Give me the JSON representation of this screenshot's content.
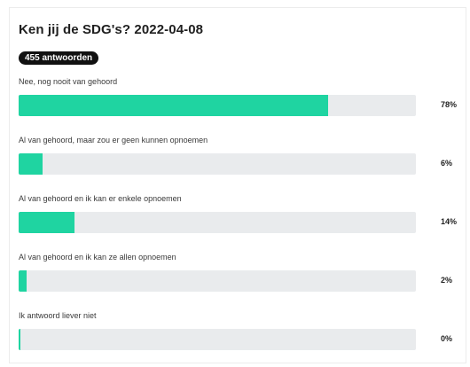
{
  "poll": {
    "title": "Ken jij de SDG's? 2022-04-08",
    "responses_label": "455 antwoorden",
    "colors": {
      "fill": "#1fd4a1",
      "track": "#e9ebed",
      "badge": "#111111"
    },
    "options": [
      {
        "label": "Nee, nog nooit van gehoord",
        "percent": 78,
        "percent_label": "78%"
      },
      {
        "label": "Al van gehoord, maar zou er geen kunnen opnoemen",
        "percent": 6,
        "percent_label": "6%"
      },
      {
        "label": "Al van gehoord en ik kan er enkele opnoemen",
        "percent": 14,
        "percent_label": "14%"
      },
      {
        "label": "Al van gehoord en ik kan ze allen opnoemen",
        "percent": 2,
        "percent_label": "2%"
      },
      {
        "label": "Ik antwoord liever niet",
        "percent": 0,
        "percent_label": "0%"
      }
    ]
  }
}
